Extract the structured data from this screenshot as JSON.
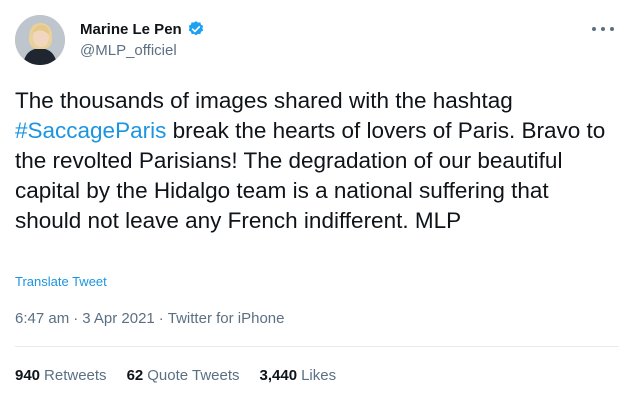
{
  "author": {
    "display_name": "Marine Le Pen",
    "handle": "@MLP_officiel",
    "verified": true,
    "avatar_icon": "profile-photo"
  },
  "tweet": {
    "text_part1": "The thousands of images shared with the hashtag ",
    "hashtag": "#SaccageParis",
    "text_part2": " break the hearts of lovers of Paris. Bravo to the revolted Parisians! The degradation of our beautiful capital by the Hidalgo team is a national suffering that should not leave any French indifferent. MLP",
    "translate_label": "Translate Tweet",
    "time": "6:47 am",
    "separator": "·",
    "date": "3 Apr 2021",
    "source": "Twitter for iPhone"
  },
  "stats": {
    "retweets_count": "940",
    "retweets_label": "Retweets",
    "quotes_count": "62",
    "quotes_label": "Quote Tweets",
    "likes_count": "3,440",
    "likes_label": "Likes"
  },
  "colors": {
    "link": "#1b95e0",
    "secondary_text": "#5b7083",
    "primary_text": "#0f1419",
    "verified_badge": "#1da1f2"
  }
}
